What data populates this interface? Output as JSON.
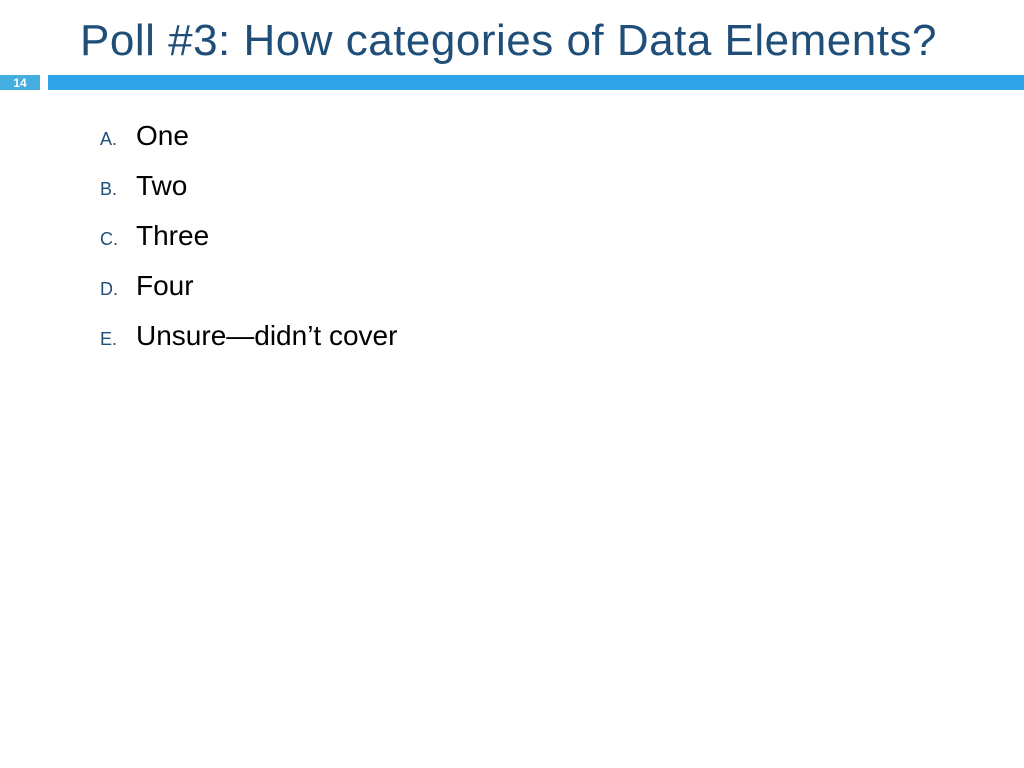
{
  "title": "Poll #3: How categories of Data Elements?",
  "page_number": "14",
  "options": [
    {
      "letter": "A.",
      "text": "One"
    },
    {
      "letter": "B.",
      "text": "Two"
    },
    {
      "letter": "C.",
      "text": "Three"
    },
    {
      "letter": "D.",
      "text": "Four"
    },
    {
      "letter": "E.",
      "text": "Unsure—didn’t cover"
    }
  ],
  "colors": {
    "title": "#1f4e79",
    "accent": "#30a4e8",
    "badge": "#44aee0"
  }
}
